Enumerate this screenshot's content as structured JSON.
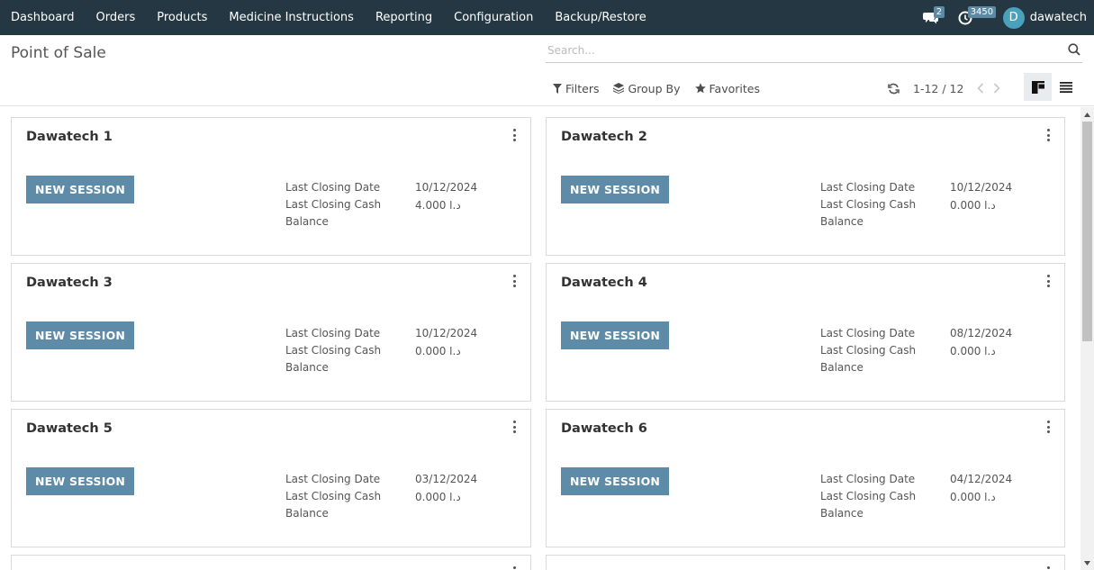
{
  "navbar": {
    "menu": [
      "Dashboard",
      "Orders",
      "Products",
      "Medicine Instructions",
      "Reporting",
      "Configuration",
      "Backup/Restore"
    ],
    "messages_count": "2",
    "activities_count": "3450",
    "user_initial": "D",
    "user_name": "dawatech"
  },
  "control": {
    "title": "Point of Sale",
    "search_placeholder": "Search...",
    "filters_label": "Filters",
    "groupby_label": "Group By",
    "favorites_label": "Favorites",
    "pager_value": "1-12 / 12"
  },
  "cards": [
    {
      "name": "Dawatech 1",
      "button": "NEW SESSION",
      "date_label": "Last Closing Date",
      "date": "10/12/2024",
      "cash_label": "Last Closing Cash",
      "cash_label_2": "Balance",
      "cash": "4.000  د.ا"
    },
    {
      "name": "Dawatech 2",
      "button": "NEW SESSION",
      "date_label": "Last Closing Date",
      "date": "10/12/2024",
      "cash_label": "Last Closing Cash",
      "cash_label_2": "Balance",
      "cash": "0.000  د.ا"
    },
    {
      "name": "Dawatech 3",
      "button": "NEW SESSION",
      "date_label": "Last Closing Date",
      "date": "10/12/2024",
      "cash_label": "Last Closing Cash",
      "cash_label_2": "Balance",
      "cash": "0.000  د.ا"
    },
    {
      "name": "Dawatech 4",
      "button": "NEW SESSION",
      "date_label": "Last Closing Date",
      "date": "08/12/2024",
      "cash_label": "Last Closing Cash",
      "cash_label_2": "Balance",
      "cash": "0.000  د.ا"
    },
    {
      "name": "Dawatech 5",
      "button": "NEW SESSION",
      "date_label": "Last Closing Date",
      "date": "03/12/2024",
      "cash_label": "Last Closing Cash",
      "cash_label_2": "Balance",
      "cash": "0.000  د.ا"
    },
    {
      "name": "Dawatech 6",
      "button": "NEW SESSION",
      "date_label": "Last Closing Date",
      "date": "04/12/2024",
      "cash_label": "Last Closing Cash",
      "cash_label_2": "Balance",
      "cash": "0.000  د.ا"
    }
  ],
  "colors": {
    "navbar": "#243742",
    "button": "#5e8ca8",
    "avatar": "#4aa1bb"
  }
}
